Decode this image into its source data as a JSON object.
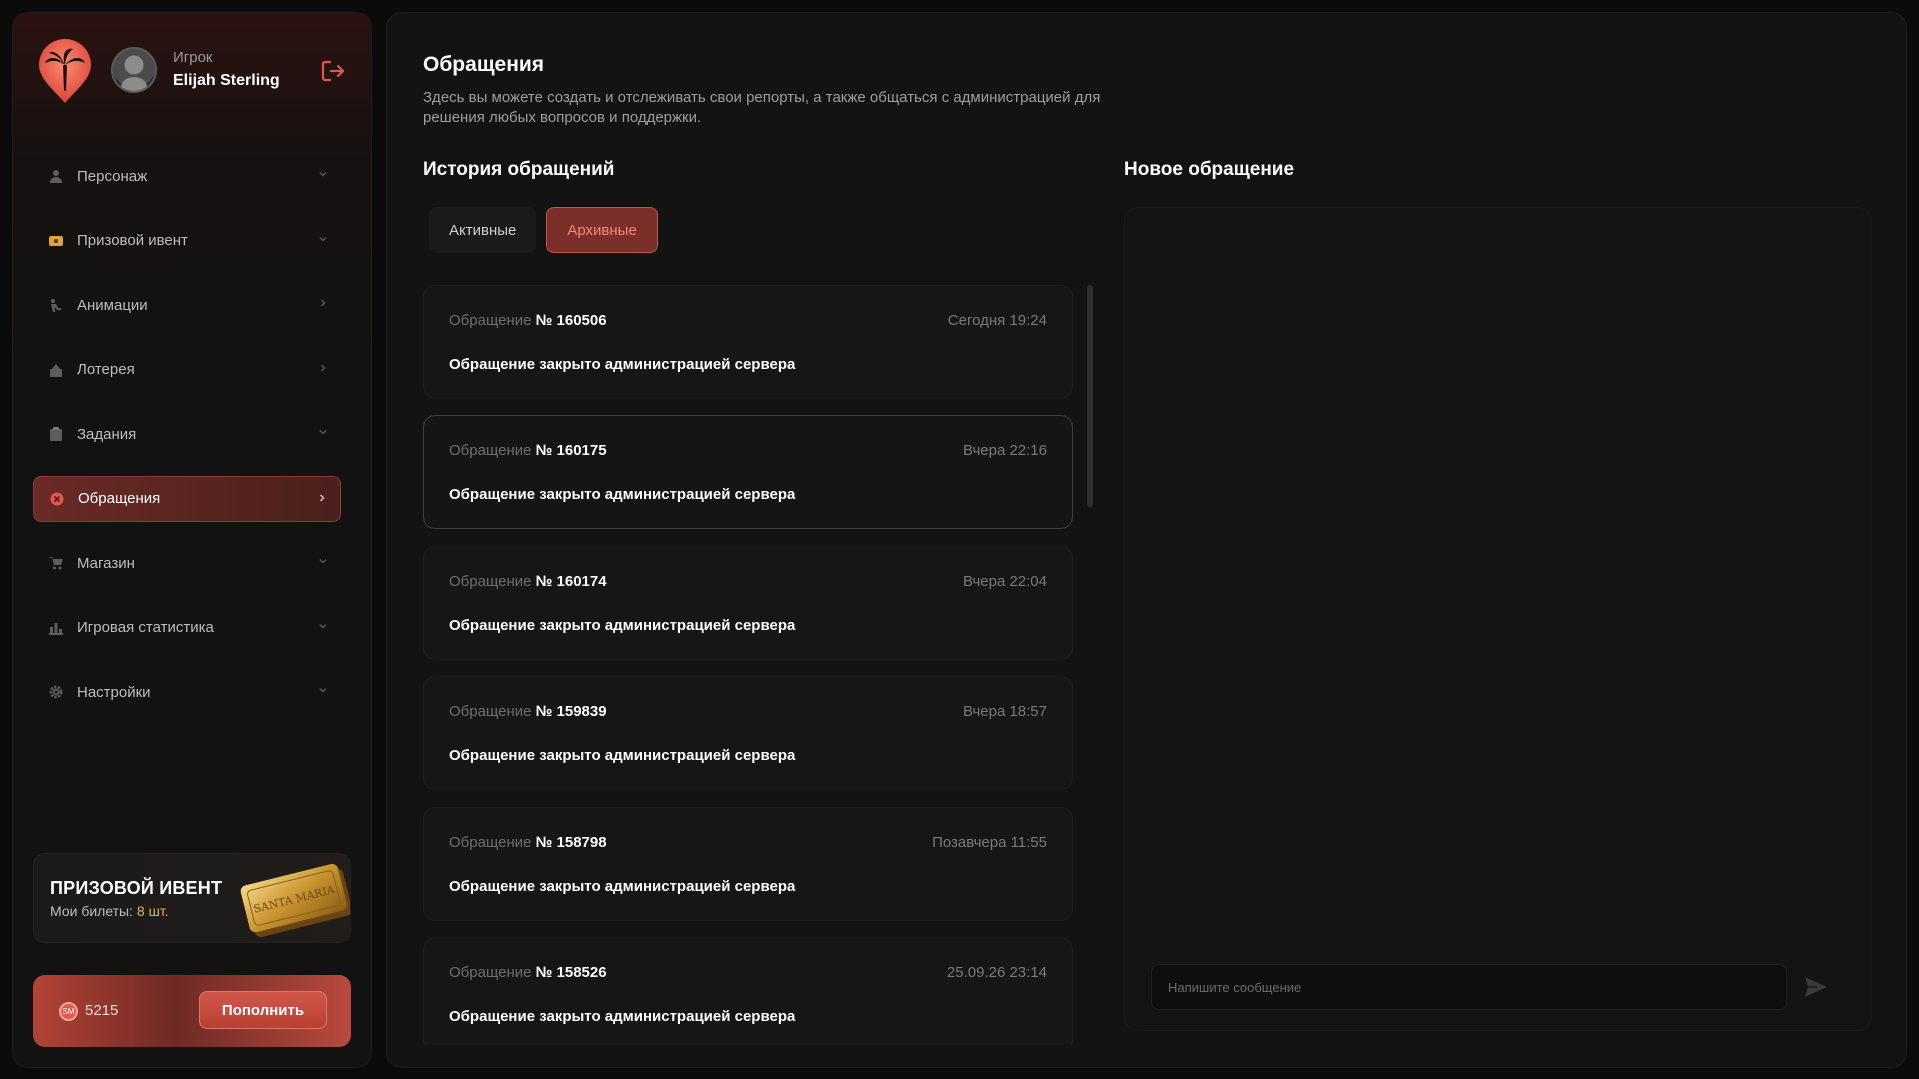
{
  "profile": {
    "role": "Игрок",
    "name": "Elijah Sterling"
  },
  "nav": {
    "items": [
      {
        "label": "Персонаж",
        "icon": "user-icon",
        "chevron": "down"
      },
      {
        "label": "Призовой ивент",
        "icon": "ticket-icon",
        "chevron": "down"
      },
      {
        "label": "Анимации",
        "icon": "animation-icon",
        "chevron": "right"
      },
      {
        "label": "Лотерея",
        "icon": "lottery-icon",
        "chevron": "right"
      },
      {
        "label": "Задания",
        "icon": "tasks-icon",
        "chevron": "down"
      },
      {
        "label": "Обращения",
        "icon": "support-icon",
        "chevron": "right",
        "active": true
      },
      {
        "label": "Магазин",
        "icon": "cart-icon",
        "chevron": "down"
      },
      {
        "label": "Игровая статистика",
        "icon": "stats-icon",
        "chevron": "down"
      },
      {
        "label": "Настройки",
        "icon": "gear-icon",
        "chevron": "down"
      }
    ]
  },
  "event": {
    "title": "ПРИЗОВОЙ ИВЕНТ",
    "tickets_label": "Мои билеты:",
    "tickets_value": "8 шт.",
    "ticket_brand": "SANTA MARIA"
  },
  "balance": {
    "coin_label": "SM",
    "value": "5215",
    "topup_label": "Пополнить"
  },
  "page": {
    "title": "Обращения",
    "description": "Здесь вы можете создать и отслеживать свои репорты, а также общаться с администрацией для решения любых вопросов и поддержки."
  },
  "history": {
    "title": "История обращений",
    "tabs": [
      {
        "label": "Активные",
        "active": false
      },
      {
        "label": "Архивные",
        "active": true
      }
    ],
    "items": [
      {
        "prefix": "Обращение",
        "number": "№ 160506",
        "time": "Сегодня 19:24",
        "status": "Обращение закрыто администрацией сервера"
      },
      {
        "prefix": "Обращение",
        "number": "№ 160175",
        "time": "Вчера 22:16",
        "status": "Обращение закрыто администрацией сервера",
        "highlight": true
      },
      {
        "prefix": "Обращение",
        "number": "№ 160174",
        "time": "Вчера 22:04",
        "status": "Обращение закрыто администрацией сервера"
      },
      {
        "prefix": "Обращение",
        "number": "№ 159839",
        "time": "Вчера 18:57",
        "status": "Обращение закрыто администрацией сервера"
      },
      {
        "prefix": "Обращение",
        "number": "№ 158798",
        "time": "Позавчера 11:55",
        "status": "Обращение закрыто администрацией сервера"
      },
      {
        "prefix": "Обращение",
        "number": "№ 158526",
        "time": "25.09.26 23:14",
        "status": "Обращение закрыто администрацией сервера"
      }
    ]
  },
  "new_ticket": {
    "title": "Новое обращение",
    "input_placeholder": "Напишите сообщение"
  },
  "colors": {
    "accent": "#c1564c",
    "accent_dark": "#7c2f28",
    "gold": "#e4b54a"
  }
}
